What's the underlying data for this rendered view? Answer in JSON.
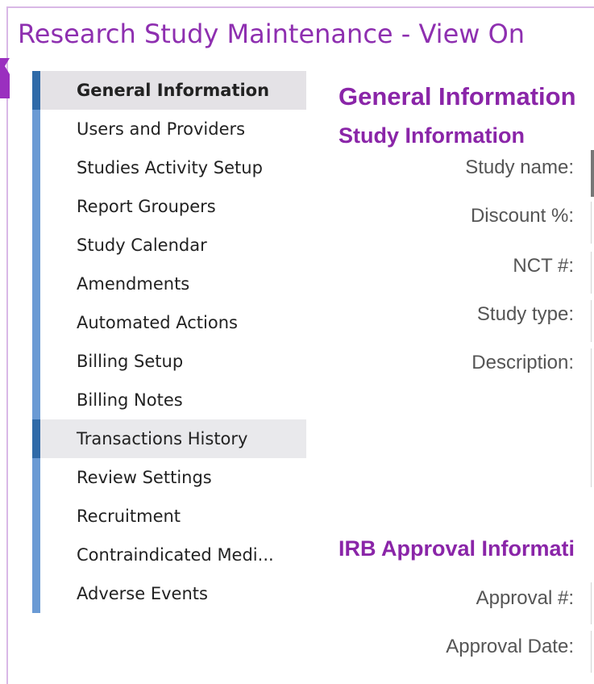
{
  "window": {
    "title": "Research Study Maintenance - View On"
  },
  "sidebar": {
    "items": [
      {
        "label": "General Information",
        "state": "active"
      },
      {
        "label": "Users and Providers",
        "state": ""
      },
      {
        "label": "Studies Activity Setup",
        "state": ""
      },
      {
        "label": "Report Groupers",
        "state": ""
      },
      {
        "label": "Study Calendar",
        "state": ""
      },
      {
        "label": "Amendments",
        "state": ""
      },
      {
        "label": "Automated Actions",
        "state": ""
      },
      {
        "label": "Billing Setup",
        "state": ""
      },
      {
        "label": "Billing Notes",
        "state": ""
      },
      {
        "label": "Transactions History",
        "state": "hover"
      },
      {
        "label": "Review Settings",
        "state": ""
      },
      {
        "label": "Recruitment",
        "state": ""
      },
      {
        "label": "Contraindicated Medi...",
        "state": ""
      },
      {
        "label": "Adverse Events",
        "state": ""
      }
    ]
  },
  "main": {
    "title": "General Information",
    "study_section": "Study Information",
    "irb_section": "IRB Approval Informati",
    "fields": {
      "study_name": "Study name:",
      "discount": "Discount %:",
      "nct": "NCT #:",
      "study_type": "Study type:",
      "description": "Description:",
      "approval_num": "Approval #:",
      "approval_date": "Approval Date:"
    }
  },
  "colors": {
    "accent": "#8e2fb0",
    "nav_bar": "#6a9ad4",
    "nav_bar_active": "#2f6aa8"
  }
}
